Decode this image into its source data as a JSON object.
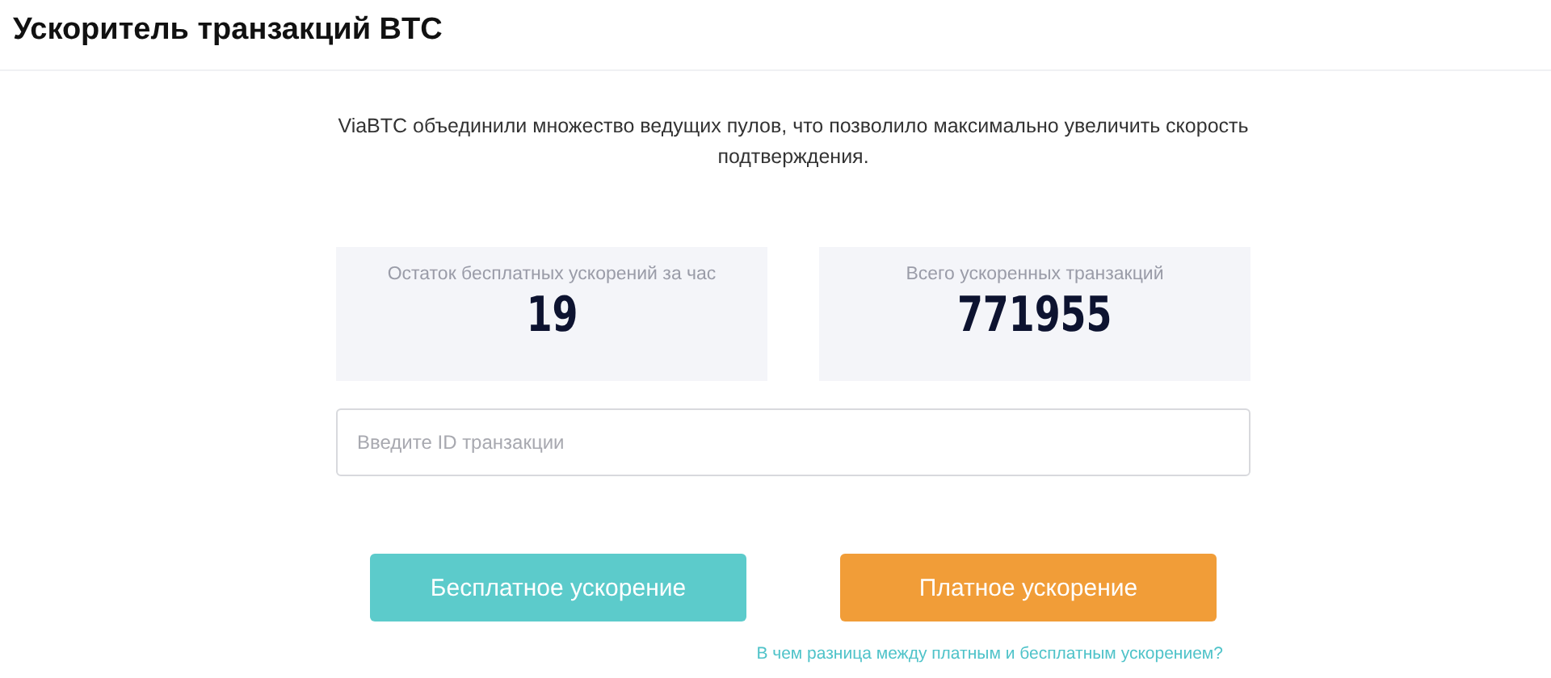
{
  "header": {
    "title": "Ускоритель транзакций BTC"
  },
  "description": "ViaBTC объединили множество ведущих пулов, что позволило максимально увеличить скорость подтверждения.",
  "stats": [
    {
      "label": "Остаток бесплатных ускорений за час",
      "value": "19"
    },
    {
      "label": "Всего ускоренных транзакций",
      "value": "771955"
    }
  ],
  "txid_field": {
    "placeholder": "Введите ID транзакции"
  },
  "buttons": [
    {
      "label": "Бесплатное ускорение",
      "kind": "free"
    },
    {
      "label": "Платное ускорение",
      "kind": "paid"
    }
  ],
  "help_link": "В чем разница между платным и бесплатным ускорением?"
}
